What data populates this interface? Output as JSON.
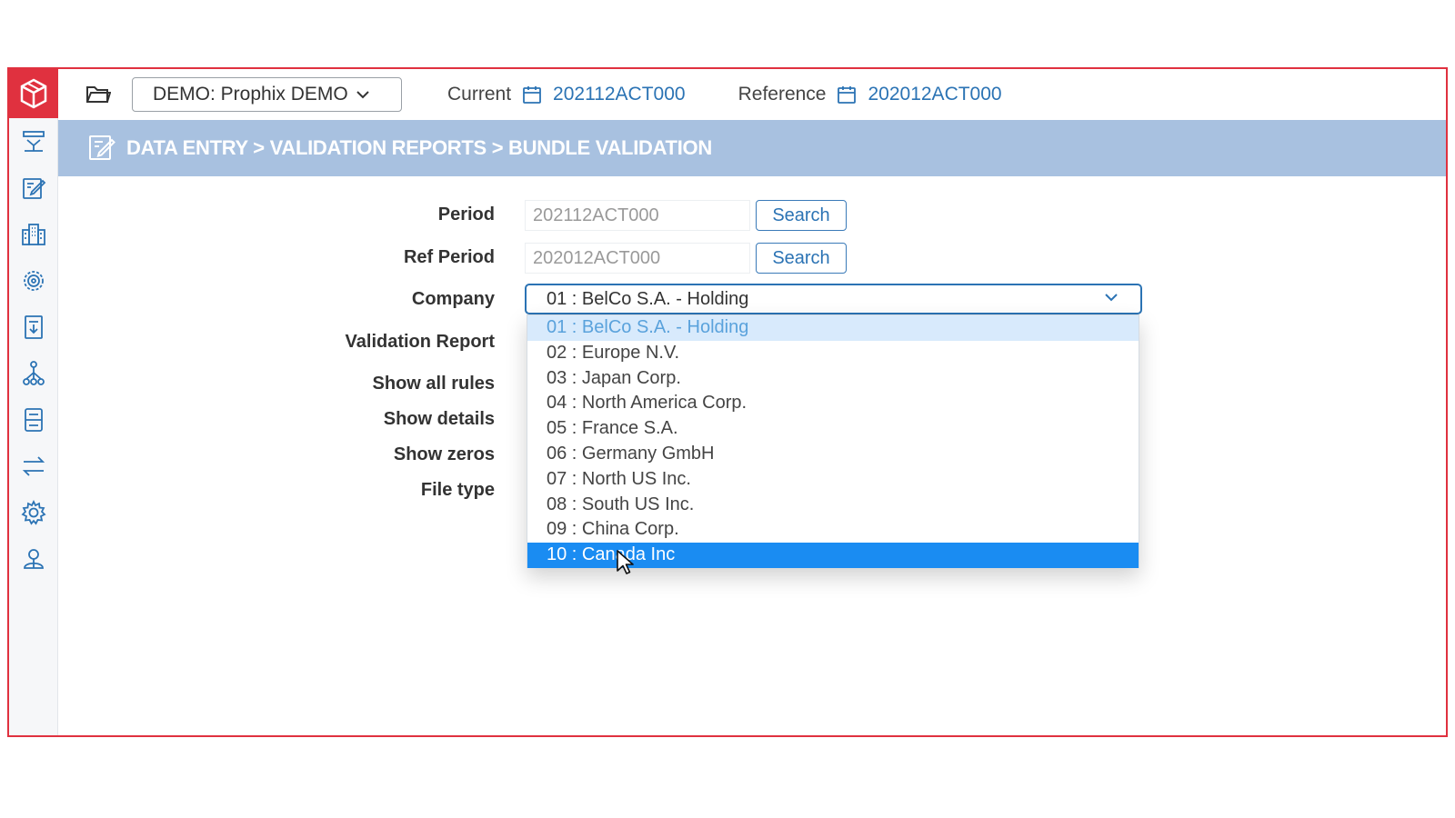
{
  "topbar": {
    "environment": "DEMO: Prophix DEMO",
    "current_label": "Current",
    "current_value": "202112ACT000",
    "reference_label": "Reference",
    "reference_value": "202012ACT000"
  },
  "breadcrumb": "DATA ENTRY > VALIDATION REPORTS > BUNDLE VALIDATION",
  "form": {
    "period_label": "Period",
    "period_value": "202112ACT000",
    "period_search": "Search",
    "ref_period_label": "Ref Period",
    "ref_period_value": "202012ACT000",
    "ref_period_search": "Search",
    "company_label": "Company",
    "company_value": "01 : BelCo S.A. - Holding",
    "validation_report_label": "Validation Report",
    "show_all_rules_label": "Show all rules",
    "show_details_label": "Show details",
    "show_zeros_label": "Show zeros",
    "file_type_label": "File type"
  },
  "company_options": [
    "01 : BelCo S.A. - Holding",
    "02 : Europe N.V.",
    "03 : Japan Corp.",
    "04 : North America Corp.",
    "05 : France S.A.",
    "06 : Germany GmbH",
    "07 : North US Inc.",
    "08 : South US Inc.",
    "09 : China Corp.",
    "10 : Canada Inc"
  ],
  "selected_option_index": 0,
  "hovered_option_index": 9,
  "sidebar_icons": [
    "consolidation-icon",
    "data-entry-icon",
    "entities-icon",
    "settings-network-icon",
    "reports-icon",
    "hierarchy-icon",
    "journal-icon",
    "transfer-icon",
    "gear-icon",
    "users-icon"
  ],
  "colors": {
    "brand": "#e0313f",
    "accent": "#2b73b4",
    "breadcrumb_band": "#a8c1e0",
    "hover_highlight": "#1a8cf2"
  }
}
